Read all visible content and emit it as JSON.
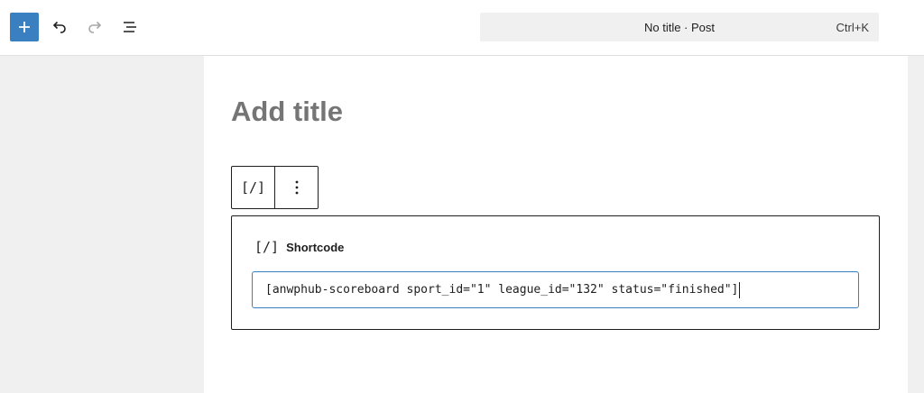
{
  "toolbar": {
    "add_icon": "plus-icon",
    "undo_icon": "undo-icon",
    "redo_icon": "redo-icon",
    "list_icon": "list-view-icon",
    "accent": "#3a7fbf"
  },
  "command_bar": {
    "label": "No title · Post",
    "shortcut": "Ctrl+K"
  },
  "editor": {
    "title_placeholder": "Add title"
  },
  "block_toolbar": {
    "type_glyph": "[/]",
    "more_icon": "vertical-ellipsis-icon"
  },
  "shortcode_block": {
    "icon_glyph": "[/]",
    "label": "Shortcode",
    "value": "[anwphub-scoreboard sport_id=\"1\" league_id=\"132\" status=\"finished\"]"
  }
}
